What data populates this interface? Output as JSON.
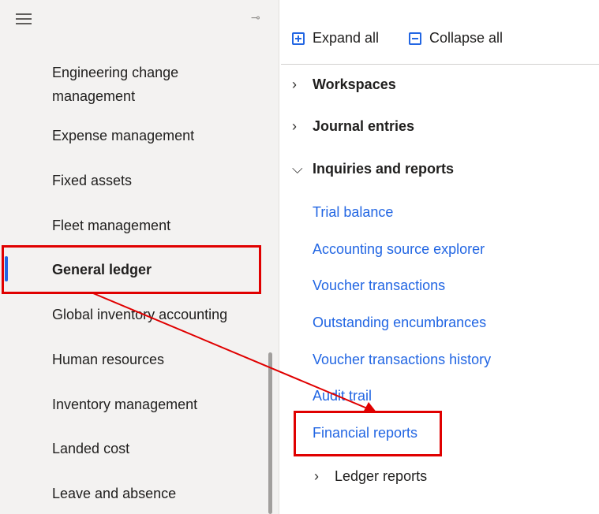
{
  "left_nav": {
    "modules": [
      {
        "label": "Engineering change management"
      },
      {
        "label": "Expense management"
      },
      {
        "label": "Fixed assets"
      },
      {
        "label": "Fleet management"
      },
      {
        "label": "General ledger"
      },
      {
        "label": "Global inventory accounting"
      },
      {
        "label": "Human resources"
      },
      {
        "label": "Inventory management"
      },
      {
        "label": "Landed cost"
      },
      {
        "label": "Leave and absence"
      }
    ],
    "selected": "General ledger"
  },
  "toolbar": {
    "expand_all": "Expand all",
    "collapse_all": "Collapse all"
  },
  "tree": {
    "workspaces": "Workspaces",
    "journal_entries": "Journal entries",
    "inquiries_and_reports": "Inquiries and reports",
    "links": [
      "Trial balance",
      "Accounting source explorer",
      "Voucher transactions",
      "Outstanding encumbrances",
      "Voucher transactions history",
      "Audit trail",
      "Financial reports"
    ],
    "ledger_reports": "Ledger reports"
  },
  "colors": {
    "accent": "#2266e3",
    "highlight": "#e00000"
  }
}
